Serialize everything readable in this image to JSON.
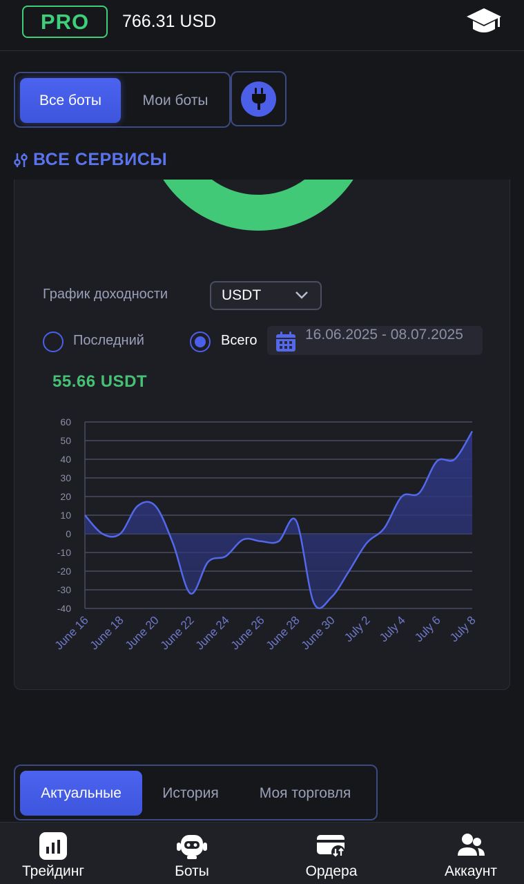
{
  "header": {
    "badge": "PRO",
    "balance": "766.31 USD",
    "icon": "graduation-cap-icon"
  },
  "bot_tabs": {
    "items": [
      {
        "label": "Все боты",
        "active": true
      },
      {
        "label": "Мои боты",
        "active": false
      }
    ],
    "plug_icon": "plug-icon"
  },
  "services": {
    "title": "ВСЕ СЕРВИСЫ",
    "icon": "sliders-icon"
  },
  "yield": {
    "label": "График доходности",
    "currency": "USDT",
    "radio_last": "Последний",
    "radio_all": "Всего",
    "selected": "all",
    "date_range": "16.06.2025 - 08.07.2025",
    "total": "55.66 USDT"
  },
  "chart_data": {
    "type": "area",
    "x": [
      "June 16",
      "June 17",
      "June 18",
      "June 19",
      "June 20",
      "June 21",
      "June 22",
      "June 23",
      "June 24",
      "June 25",
      "June 26",
      "June 27",
      "June 28",
      "June 29",
      "June 30",
      "July 1",
      "July 2",
      "July 3",
      "July 4",
      "July 5",
      "July 6",
      "July 7",
      "July 8"
    ],
    "values": [
      10,
      0,
      0,
      15,
      15,
      -5,
      -32,
      -15,
      -12,
      -3,
      -4,
      -4,
      7,
      -37,
      -34,
      -20,
      -5,
      3,
      20,
      22,
      39,
      40,
      55
    ],
    "x_tick_labels": [
      "June 16",
      "June 18",
      "June 20",
      "June 22",
      "June 24",
      "June 26",
      "June 28",
      "June 30",
      "July 2",
      "July 4",
      "July 6",
      "July 8"
    ],
    "y_ticks": [
      "60",
      "50",
      "40",
      "30",
      "20",
      "10",
      "0",
      "-10",
      "-20",
      "-30",
      "-40"
    ],
    "ylim": [
      -40,
      60
    ],
    "grid": true,
    "line_color": "#5368ea",
    "fill_color": "#2d3680"
  },
  "trade_tabs": {
    "items": [
      {
        "label": "Актуальные",
        "active": true
      },
      {
        "label": "История",
        "active": false
      },
      {
        "label": "Моя торговля",
        "active": false
      }
    ]
  },
  "nav": {
    "items": [
      {
        "label": "Трейдинг",
        "icon": "chart-bars-icon"
      },
      {
        "label": "Боты",
        "icon": "robot-icon"
      },
      {
        "label": "Ордера",
        "icon": "card-exchange-icon"
      },
      {
        "label": "Аккаунт",
        "icon": "user-group-icon"
      }
    ]
  },
  "colors": {
    "accent": "#4b5fe8",
    "green": "#42c978",
    "background": "#16171b"
  }
}
